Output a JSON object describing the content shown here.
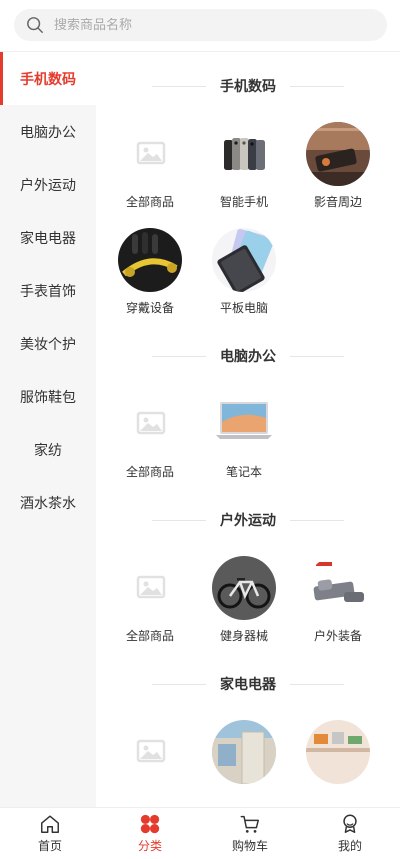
{
  "search": {
    "placeholder": "搜索商品名称",
    "value": ""
  },
  "sidebar": {
    "items": [
      {
        "label": "手机数码",
        "active": true
      },
      {
        "label": "电脑办公",
        "active": false
      },
      {
        "label": "户外运动",
        "active": false
      },
      {
        "label": "家电电器",
        "active": false
      },
      {
        "label": "手表首饰",
        "active": false
      },
      {
        "label": "美妆个护",
        "active": false
      },
      {
        "label": "服饰鞋包",
        "active": false
      },
      {
        "label": "家纺",
        "active": false
      },
      {
        "label": "酒水茶水",
        "active": false
      }
    ]
  },
  "sections": [
    {
      "title": "手机数码",
      "items": [
        {
          "label": "全部商品",
          "icon": "image-placeholder-icon"
        },
        {
          "label": "智能手机",
          "icon": "phones-image"
        },
        {
          "label": "影音周边",
          "icon": "speaker-image"
        },
        {
          "label": "穿戴设备",
          "icon": "earphones-image"
        },
        {
          "label": "平板电脑",
          "icon": "tablet-image"
        }
      ]
    },
    {
      "title": "电脑办公",
      "items": [
        {
          "label": "全部商品",
          "icon": "image-placeholder-icon"
        },
        {
          "label": "笔记本",
          "icon": "laptop-image"
        }
      ]
    },
    {
      "title": "户外运动",
      "items": [
        {
          "label": "全部商品",
          "icon": "image-placeholder-icon"
        },
        {
          "label": "健身器械",
          "icon": "bicycle-image"
        },
        {
          "label": "户外装备",
          "icon": "sleeping-mat-image"
        }
      ]
    },
    {
      "title": "家电电器",
      "items": [
        {
          "label": "",
          "icon": "image-placeholder-icon"
        },
        {
          "label": "",
          "icon": "fridge-image"
        },
        {
          "label": "",
          "icon": "kitchen-image"
        }
      ]
    }
  ],
  "tabbar": {
    "items": [
      {
        "label": "首页",
        "icon": "home-icon",
        "active": false
      },
      {
        "label": "分类",
        "icon": "category-icon",
        "active": true
      },
      {
        "label": "购物车",
        "icon": "cart-icon",
        "active": false
      },
      {
        "label": "我的",
        "icon": "profile-icon",
        "active": false
      }
    ]
  },
  "colors": {
    "accent": "#e53b2c",
    "sidebar_bg": "#f6f6f6"
  }
}
